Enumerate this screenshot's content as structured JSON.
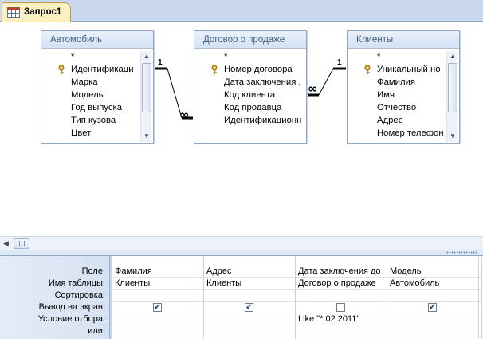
{
  "tab": {
    "label": "Запрос1",
    "icon": "query-icon"
  },
  "tables": [
    {
      "title": "Автомобиль",
      "fields": [
        {
          "name": "*",
          "key": false
        },
        {
          "name": "Идентификаци",
          "key": true
        },
        {
          "name": "Марка",
          "key": false
        },
        {
          "name": "Модель",
          "key": false
        },
        {
          "name": "Год выпуска",
          "key": false
        },
        {
          "name": "Тип кузова",
          "key": false
        },
        {
          "name": "Цвет",
          "key": false
        }
      ]
    },
    {
      "title": "Договор о продаже",
      "fields": [
        {
          "name": "*",
          "key": false
        },
        {
          "name": "Номер договора",
          "key": true
        },
        {
          "name": "Дата заключения ,",
          "key": false
        },
        {
          "name": "Код клиента",
          "key": false
        },
        {
          "name": "Код продавца",
          "key": false
        },
        {
          "name": "Идентификационн",
          "key": false
        }
      ]
    },
    {
      "title": "Клиенты",
      "fields": [
        {
          "name": "*",
          "key": false
        },
        {
          "name": "Уникальный но",
          "key": true
        },
        {
          "name": "Фамилия",
          "key": false
        },
        {
          "name": "Имя",
          "key": false
        },
        {
          "name": "Отчество",
          "key": false
        },
        {
          "name": "Адрес",
          "key": false
        },
        {
          "name": "Номер телефон",
          "key": false
        }
      ]
    }
  ],
  "joins": [
    {
      "from": "Автомобиль",
      "to": "Договор о продаже",
      "one_label": "1",
      "many_label": "∞"
    },
    {
      "from": "Клиенты",
      "to": "Договор о продаже",
      "one_label": "1",
      "many_label": "∞"
    }
  ],
  "grid": {
    "row_labels": [
      "Поле:",
      "Имя таблицы:",
      "Сортировка:",
      "Вывод на экран:",
      "Условие отбора:",
      "или:"
    ],
    "columns": [
      {
        "field": "Фамилия",
        "table": "Клиенты",
        "sort": "",
        "show": true,
        "criteria": "",
        "or": ""
      },
      {
        "field": "Адрес",
        "table": "Клиенты",
        "sort": "",
        "show": true,
        "criteria": "",
        "or": ""
      },
      {
        "field": "Дата заключения до",
        "table": "Договор о продаже",
        "sort": "",
        "show": false,
        "criteria": "Like \"*.02.2011\"",
        "or": ""
      },
      {
        "field": "Модель",
        "table": "Автомобиль",
        "sort": "",
        "show": true,
        "criteria": "",
        "or": ""
      },
      {
        "field": "",
        "table": "",
        "sort": "",
        "show": false,
        "criteria": "",
        "or": ""
      }
    ]
  }
}
